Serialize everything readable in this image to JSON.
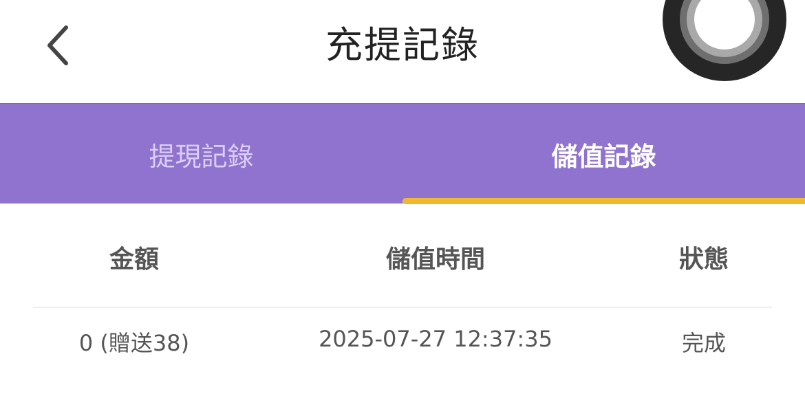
{
  "header": {
    "title": "充提記錄",
    "back_icon": "chevron-left-icon"
  },
  "tabs": [
    {
      "label": "提現記錄",
      "active": false
    },
    {
      "label": "儲值記錄",
      "active": true
    }
  ],
  "colors": {
    "tab_bar": "#8f73cf",
    "tab_indicator": "#f0b82c",
    "inactive_tab_text": "#dccff5",
    "active_tab_text": "#ffffff"
  },
  "table": {
    "columns": [
      "金額",
      "儲值時間",
      "狀態"
    ],
    "rows": [
      [
        "0 (贈送38)",
        "2025-07-27 12:37:35",
        "完成"
      ]
    ]
  },
  "overlay": {
    "assistive_touch_icon": "assistive-touch-icon"
  }
}
